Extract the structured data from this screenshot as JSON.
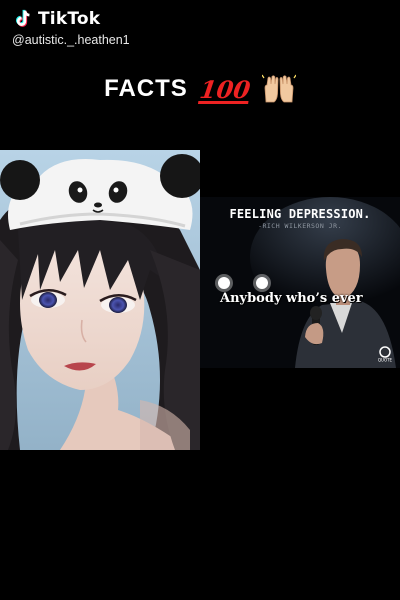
{
  "watermark": {
    "app_name": "TikTok",
    "username": "@autistic._.heathen1",
    "logo_icon": "tiktok-note-icon"
  },
  "caption": {
    "text": "FACTS",
    "emoji_100": "100",
    "hands_icon": "raised-hands-icon"
  },
  "left_panel": {
    "image": "anime-girl-panda-hat-illustration"
  },
  "right_panel": {
    "quote_title": "FEELING DEPRESSION.",
    "quote_author": "-RICH WILKERSON JR.",
    "subtitle": "Anybody who’s ever",
    "channel_logo_text": "QUOTE",
    "colors": {
      "background": "#06080c",
      "title": "#ffffff",
      "author": "#8e96a0"
    }
  }
}
